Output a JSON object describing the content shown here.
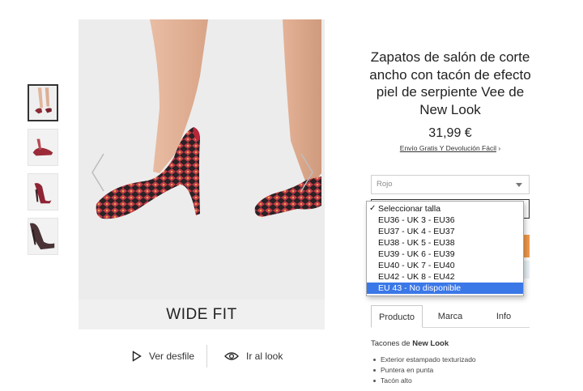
{
  "gallery": {
    "thumbnails": [
      "thumb-1",
      "thumb-2",
      "thumb-3",
      "thumb-4"
    ],
    "active_index": 0,
    "banner": "WIDE FIT",
    "actions": {
      "catwalk_label": "Ver desfile",
      "look_label": "Ir al look"
    }
  },
  "product": {
    "title": "Zapatos de salón de corte ancho con tacón de efecto piel de serpiente Vee de New Look",
    "price": "31,99 €",
    "shipping_link": "Envío Gratis Y Devolución Fácil",
    "shipping_chevron": "›"
  },
  "selectors": {
    "colour_value": "Rojo",
    "size_options": [
      "Seleccionar talla",
      "EU36 - UK 3 - EU36",
      "EU37 - UK 4 - EU37",
      "EU38 - UK 5 - EU38",
      "EU39 - UK 6 - EU39",
      "EU40 - UK 7 - EU40",
      "EU42 - UK 8 - EU42",
      "EU 43 - No disponible"
    ],
    "checked_index": 0,
    "highlighted_index": 7,
    "check_mark": "✓"
  },
  "tabs": [
    "Producto",
    "Marca",
    "Info"
  ],
  "description": {
    "brand_prefix": "Tacones de ",
    "brand_name": "New Look",
    "bullets": [
      "Exterior estampado texturizado",
      "Puntera en punta",
      "Tacón alto"
    ]
  },
  "colors": {
    "accent_orange": "#f29a4b",
    "highlight_blue": "#3b78e7"
  },
  "icons": {
    "play": "play-icon",
    "eye": "eye-icon",
    "prev": "chevron-left-icon",
    "next": "chevron-right-icon"
  }
}
